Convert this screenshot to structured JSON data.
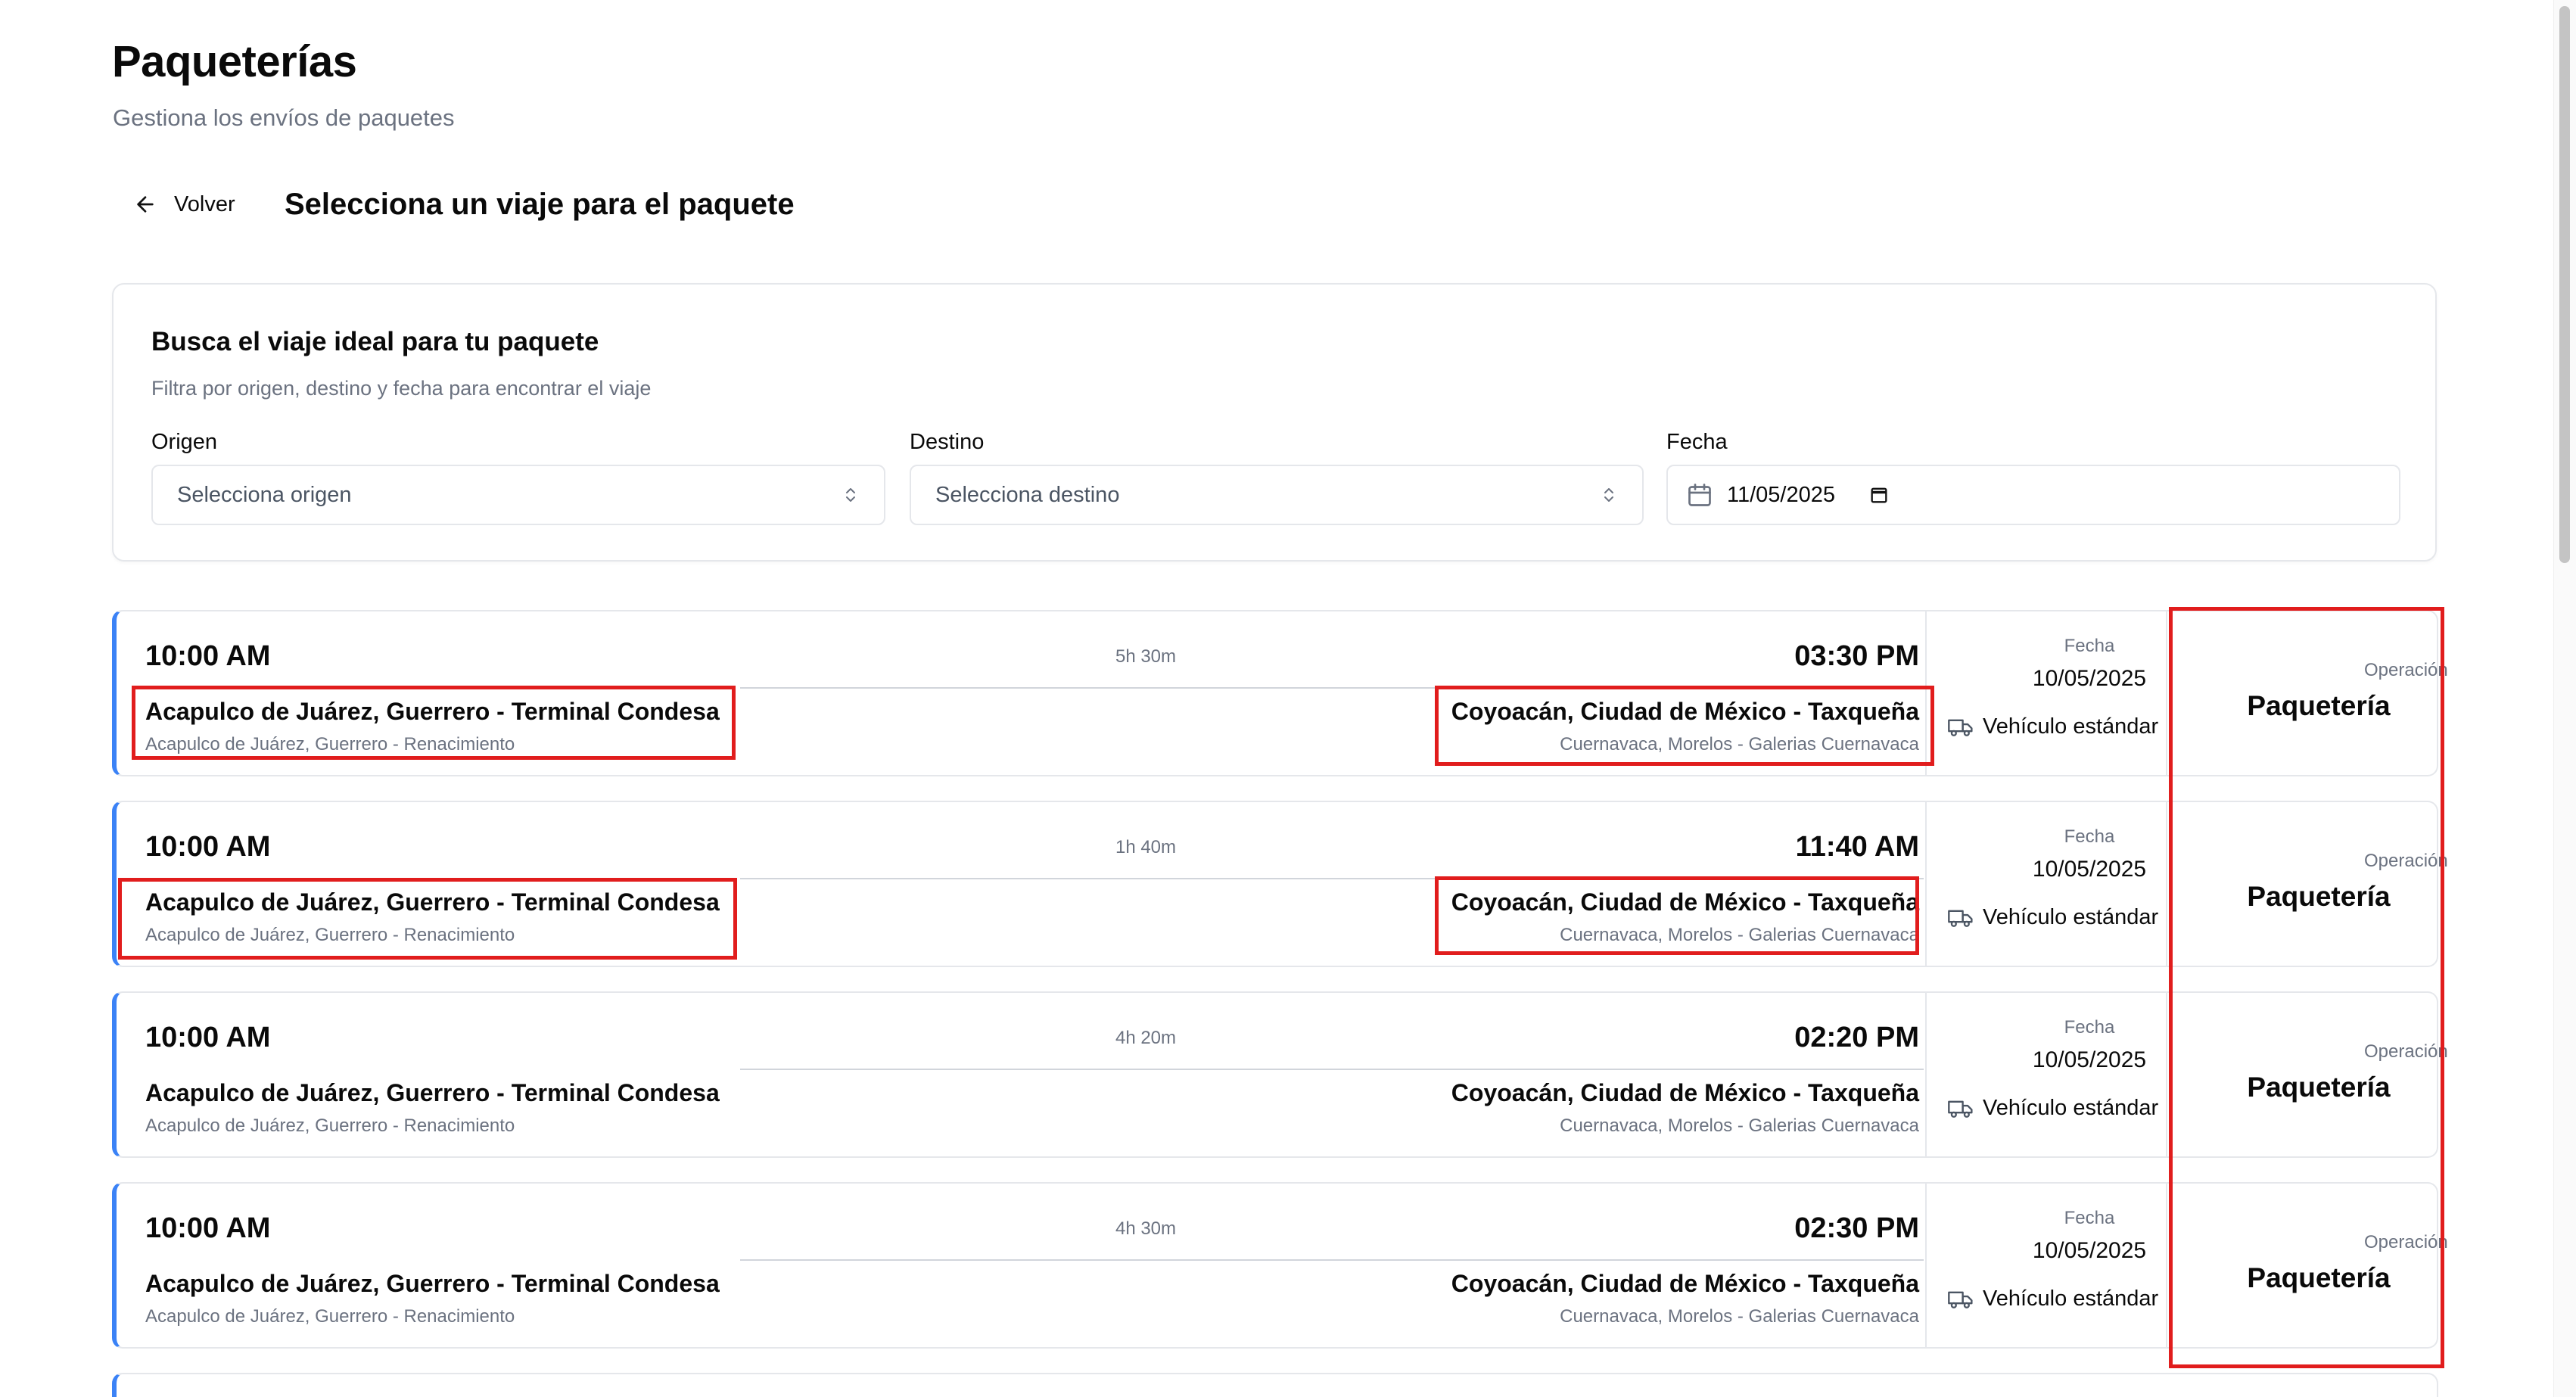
{
  "header": {
    "title": "Paqueterías",
    "subtitle": "Gestiona los envíos de paquetes"
  },
  "nav": {
    "back_label": "Volver",
    "step_title": "Selecciona un viaje para el paquete"
  },
  "filters": {
    "title": "Busca el viaje ideal para tu paquete",
    "description": "Filtra por origen, destino y fecha para encontrar el viaje",
    "origin": {
      "label": "Origen",
      "placeholder": "Selecciona origen"
    },
    "destination": {
      "label": "Destino",
      "placeholder": "Selecciona destino"
    },
    "date": {
      "label": "Fecha",
      "value": "11/05/2025"
    }
  },
  "trips": [
    {
      "departure": "10:00 AM",
      "duration": "5h 30m",
      "arrival": "03:30 PM",
      "origin": "Acapulco de Juárez, Guerrero - Terminal Condesa",
      "origin_sub": "Acapulco de Juárez, Guerrero - Renacimiento",
      "destination": "Coyoacán, Ciudad de México - Taxqueña",
      "destination_sub": "Cuernavaca, Morelos - Galerias Cuernavaca",
      "date_label": "Fecha",
      "date": "10/05/2025",
      "vehicle": "Vehículo estándar",
      "operation_label": "Operación",
      "operation": "Paquetería"
    },
    {
      "departure": "10:00 AM",
      "duration": "1h 40m",
      "arrival": "11:40 AM",
      "origin": "Acapulco de Juárez, Guerrero - Terminal Condesa",
      "origin_sub": "Acapulco de Juárez, Guerrero - Renacimiento",
      "destination": "Coyoacán, Ciudad de México - Taxqueña",
      "destination_sub": "Cuernavaca, Morelos - Galerias Cuernavaca",
      "date_label": "Fecha",
      "date": "10/05/2025",
      "vehicle": "Vehículo estándar",
      "operation_label": "Operación",
      "operation": "Paquetería"
    },
    {
      "departure": "10:00 AM",
      "duration": "4h 20m",
      "arrival": "02:20 PM",
      "origin": "Acapulco de Juárez, Guerrero - Terminal Condesa",
      "origin_sub": "Acapulco de Juárez, Guerrero - Renacimiento",
      "destination": "Coyoacán, Ciudad de México - Taxqueña",
      "destination_sub": "Cuernavaca, Morelos - Galerias Cuernavaca",
      "date_label": "Fecha",
      "date": "10/05/2025",
      "vehicle": "Vehículo estándar",
      "operation_label": "Operación",
      "operation": "Paquetería"
    },
    {
      "departure": "10:00 AM",
      "duration": "4h 30m",
      "arrival": "02:30 PM",
      "origin": "Acapulco de Juárez, Guerrero - Terminal Condesa",
      "origin_sub": "Acapulco de Juárez, Guerrero - Renacimiento",
      "destination": "Coyoacán, Ciudad de México - Taxqueña",
      "destination_sub": "Cuernavaca, Morelos - Galerias Cuernavaca",
      "date_label": "Fecha",
      "date": "10/05/2025",
      "vehicle": "Vehículo estándar",
      "operation_label": "Operación",
      "operation": "Paquetería"
    }
  ],
  "colors": {
    "accent": "#3b82f6",
    "highlight": "#e11d1d",
    "muted_text": "#6b7280",
    "border": "#e5e7eb"
  }
}
